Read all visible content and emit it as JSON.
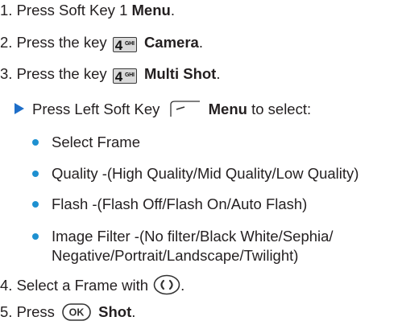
{
  "steps": [
    {
      "number": "1.",
      "prefix": "Press Soft Key 1",
      "bold": "Menu",
      "suffix": "."
    },
    {
      "number": "2.",
      "prefix": "Press the key",
      "key": {
        "digit": "4",
        "letters": "GHI"
      },
      "bold": "Camera",
      "suffix": "."
    },
    {
      "number": "3.",
      "prefix": "Press the key",
      "key": {
        "digit": "4",
        "letters": "GHI"
      },
      "bold": "Multi Shot",
      "suffix": "."
    },
    {
      "number": "4.",
      "prefix": "Select a Frame with",
      "suffix": "."
    },
    {
      "number": "5.",
      "prefix": "Press",
      "ok_label": "OK",
      "bold": "Shot",
      "suffix": "."
    }
  ],
  "sub_instruction": {
    "prefix": "Press Left Soft Key",
    "bold": "Menu",
    "suffix": "to select:"
  },
  "options": [
    {
      "line1": "Select Frame"
    },
    {
      "line1": "Quality -(High Quality/Mid Quality/Low Quality)"
    },
    {
      "line1": "Flash -(Flash Off/Flash On/Auto Flash)"
    },
    {
      "line1": "Image Filter -(No filter/Black White/Sephia/",
      "line2": "Negative/Portrait/Landscape/Twilight)"
    }
  ],
  "colors": {
    "text": "#231f20",
    "arrow": "#1e6ec8",
    "bullet": "#1e90d0",
    "keycap": "#d9d9d9"
  },
  "icons": {
    "arrow": "right-triangle-icon",
    "soft_key": "left-soft-key-icon",
    "nav": "left-right-navigation-key-icon",
    "ok": "ok-key-icon"
  }
}
